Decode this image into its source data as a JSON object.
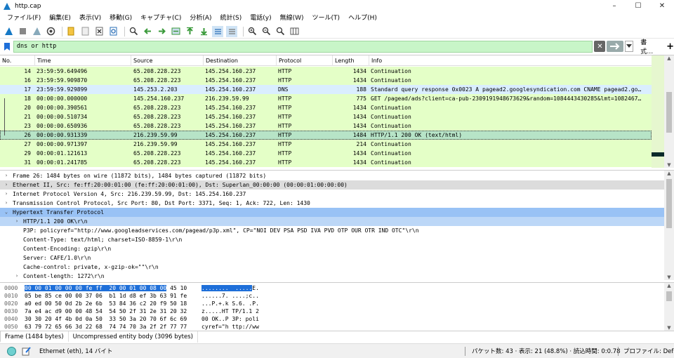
{
  "window": {
    "title": "http.cap",
    "controls": [
      "–",
      "☐",
      "✕"
    ]
  },
  "menu": [
    "ファイル(F)",
    "編集(E)",
    "表示(V)",
    "移動(G)",
    "キャプチャ(C)",
    "分析(A)",
    "統計(S)",
    "電話(y)",
    "無線(W)",
    "ツール(T)",
    "ヘルプ(H)"
  ],
  "toolbar": {
    "icons": [
      "shark-fin-start-icon",
      "stop-icon",
      "restart-icon",
      "options-icon",
      "open-file-icon",
      "save-file-icon",
      "close-file-icon",
      "reload-icon",
      "find-icon",
      "go-back-icon",
      "go-forward-icon",
      "go-to-packet-icon",
      "go-first-icon",
      "go-last-icon",
      "autoscroll-icon",
      "colorize-icon",
      "zoom-in-icon",
      "zoom-out-icon",
      "zoom-normal-icon",
      "resize-columns-icon"
    ]
  },
  "filter": {
    "value": "dns or http",
    "expression_label": "書式…",
    "add_label": "+",
    "bg_color": "#c8f5c8"
  },
  "packet_list": {
    "columns": [
      "No.",
      "Time",
      "Source",
      "Destination",
      "Protocol",
      "Length",
      "Info"
    ],
    "rows": [
      {
        "no": "14",
        "time": "23:59:59.649496",
        "src": "65.208.228.223",
        "dst": "145.254.160.237",
        "proto": "HTTP",
        "len": "1434",
        "info": "Continuation",
        "color": "#e4ffc7"
      },
      {
        "no": "16",
        "time": "23:59:59.909870",
        "src": "65.208.228.223",
        "dst": "145.254.160.237",
        "proto": "HTTP",
        "len": "1434",
        "info": "Continuation",
        "color": "#e4ffc7"
      },
      {
        "no": "17",
        "time": "23:59:59.929899",
        "src": "145.253.2.203",
        "dst": "145.254.160.237",
        "proto": "DNS",
        "len": "188",
        "info": "Standard query response 0x0023 A pagead2.googlesyndication.com CNAME pagead2.go…",
        "color": "#daeeff"
      },
      {
        "no": "18",
        "time": "00:00:00.000000",
        "src": "145.254.160.237",
        "dst": "216.239.59.99",
        "proto": "HTTP",
        "len": "775",
        "info": "GET /pagead/ads?client=ca-pub-2309191948673629&random=1084443430285&lmt=1082467…",
        "color": "#e4ffc7"
      },
      {
        "no": "20",
        "time": "00:00:00.390561",
        "src": "65.208.228.223",
        "dst": "145.254.160.237",
        "proto": "HTTP",
        "len": "1434",
        "info": "Continuation",
        "color": "#e4ffc7"
      },
      {
        "no": "21",
        "time": "00:00:00.510734",
        "src": "65.208.228.223",
        "dst": "145.254.160.237",
        "proto": "HTTP",
        "len": "1434",
        "info": "Continuation",
        "color": "#e4ffc7"
      },
      {
        "no": "23",
        "time": "00:00:00.650936",
        "src": "65.208.228.223",
        "dst": "145.254.160.237",
        "proto": "HTTP",
        "len": "1434",
        "info": "Continuation",
        "color": "#e4ffc7"
      },
      {
        "no": "26",
        "time": "00:00:00.931339",
        "src": "216.239.59.99",
        "dst": "145.254.160.237",
        "proto": "HTTP",
        "len": "1484",
        "info": "HTTP/1.1 200 OK  (text/html)",
        "color": "#b7e4c7",
        "selected": true
      },
      {
        "no": "27",
        "time": "00:00:00.971397",
        "src": "216.239.59.99",
        "dst": "145.254.160.237",
        "proto": "HTTP",
        "len": "214",
        "info": "Continuation",
        "color": "#e4ffc7"
      },
      {
        "no": "29",
        "time": "00:00:01.121613",
        "src": "65.208.228.223",
        "dst": "145.254.160.237",
        "proto": "HTTP",
        "len": "1434",
        "info": "Continuation",
        "color": "#e4ffc7"
      },
      {
        "no": "31",
        "time": "00:00:01.241785",
        "src": "65.208.228.223",
        "dst": "145.254.160.237",
        "proto": "HTTP",
        "len": "1434",
        "info": "Continuation",
        "color": "#e4ffc7"
      }
    ]
  },
  "details": [
    {
      "text": "Frame 26: 1484 bytes on wire (11872 bits), 1484 bytes captured (11872 bits)",
      "arrow": ">",
      "indent": 0,
      "bg": "#ffffff"
    },
    {
      "text": "Ethernet II, Src: fe:ff:20:00:01:00 (fe:ff:20:00:01:00), Dst: Superlan_00:00:00 (00:00:01:00:00:00)",
      "arrow": ">",
      "indent": 0,
      "bg": "#dcdcdc"
    },
    {
      "text": "Internet Protocol Version 4, Src: 216.239.59.99, Dst: 145.254.160.237",
      "arrow": ">",
      "indent": 0,
      "bg": "#ffffff"
    },
    {
      "text": "Transmission Control Protocol, Src Port: 80, Dst Port: 3371, Seq: 1, Ack: 722, Len: 1430",
      "arrow": ">",
      "indent": 0,
      "bg": "#ffffff"
    },
    {
      "text": "Hypertext Transfer Protocol",
      "arrow": "v",
      "indent": 0,
      "bg": "#99c2f5"
    },
    {
      "text": "HTTP/1.1 200 OK\\r\\n",
      "arrow": ">",
      "indent": 1,
      "bg": "#bcd7f7"
    },
    {
      "text": "P3P: policyref=\"http://www.googleadservices.com/pagead/p3p.xml\", CP=\"NOI DEV PSA PSD IVA PVD OTP OUR OTR IND OTC\"\\r\\n",
      "arrow": "",
      "indent": 1,
      "bg": "#ffffff"
    },
    {
      "text": "Content-Type: text/html; charset=ISO-8859-1\\r\\n",
      "arrow": "",
      "indent": 1,
      "bg": "#ffffff"
    },
    {
      "text": "Content-Encoding: gzip\\r\\n",
      "arrow": "",
      "indent": 1,
      "bg": "#ffffff"
    },
    {
      "text": "Server: CAFE/1.0\\r\\n",
      "arrow": "",
      "indent": 1,
      "bg": "#ffffff"
    },
    {
      "text": "Cache-control: private, x-gzip-ok=\"\"\\r\\n",
      "arrow": "",
      "indent": 1,
      "bg": "#ffffff"
    },
    {
      "text": "Content-length: 1272\\r\\n",
      "arrow": ">",
      "indent": 1,
      "bg": "#ffffff"
    }
  ],
  "bytes": [
    {
      "offset": "0000",
      "hex_hl": "00 00 01 00 00 00 fe ff  20 00 01 00 08 00",
      "hex_rest": " 45 10",
      "ascii_hl": "........  .....",
      "ascii_rest": "E."
    },
    {
      "offset": "0010",
      "hex_hl": "",
      "hex_rest": "05 be 85 ce 00 00 37 06  b1 1d d8 ef 3b 63 91 fe",
      "ascii_hl": "",
      "ascii_rest": "......7. ....;c.."
    },
    {
      "offset": "0020",
      "hex_hl": "",
      "hex_rest": "a0 ed 00 50 0d 2b 2e 6b  53 84 36 c2 20 f9 50 18",
      "ascii_hl": "",
      "ascii_rest": "...P.+.k S.6. .P."
    },
    {
      "offset": "0030",
      "hex_hl": "",
      "hex_rest": "7a e4 ac d9 00 00 48 54  54 50 2f 31 2e 31 20 32",
      "ascii_hl": "",
      "ascii_rest": "z.....HT TP/1.1 2"
    },
    {
      "offset": "0040",
      "hex_hl": "",
      "hex_rest": "30 30 20 4f 4b 0d 0a 50  33 50 3a 20 70 6f 6c 69",
      "ascii_hl": "",
      "ascii_rest": "00 OK..P 3P: poli"
    },
    {
      "offset": "0050",
      "hex_hl": "",
      "hex_rest": "63 79 72 65 66 3d 22 68  74 74 70 3a 2f 2f 77 77",
      "ascii_hl": "",
      "ascii_rest": "cyref=\"h ttp://ww"
    }
  ],
  "byte_tabs": [
    "Frame (1484 bytes)",
    "Uncompressed entity body (3096 bytes)"
  ],
  "status": {
    "left": "Ethernet (eth), 14 バイト",
    "packets": "パケット数: 43 · 表示: 21 (48.8%) · 読込時間: 0:0.78",
    "profile": "プロファイル: Default"
  }
}
